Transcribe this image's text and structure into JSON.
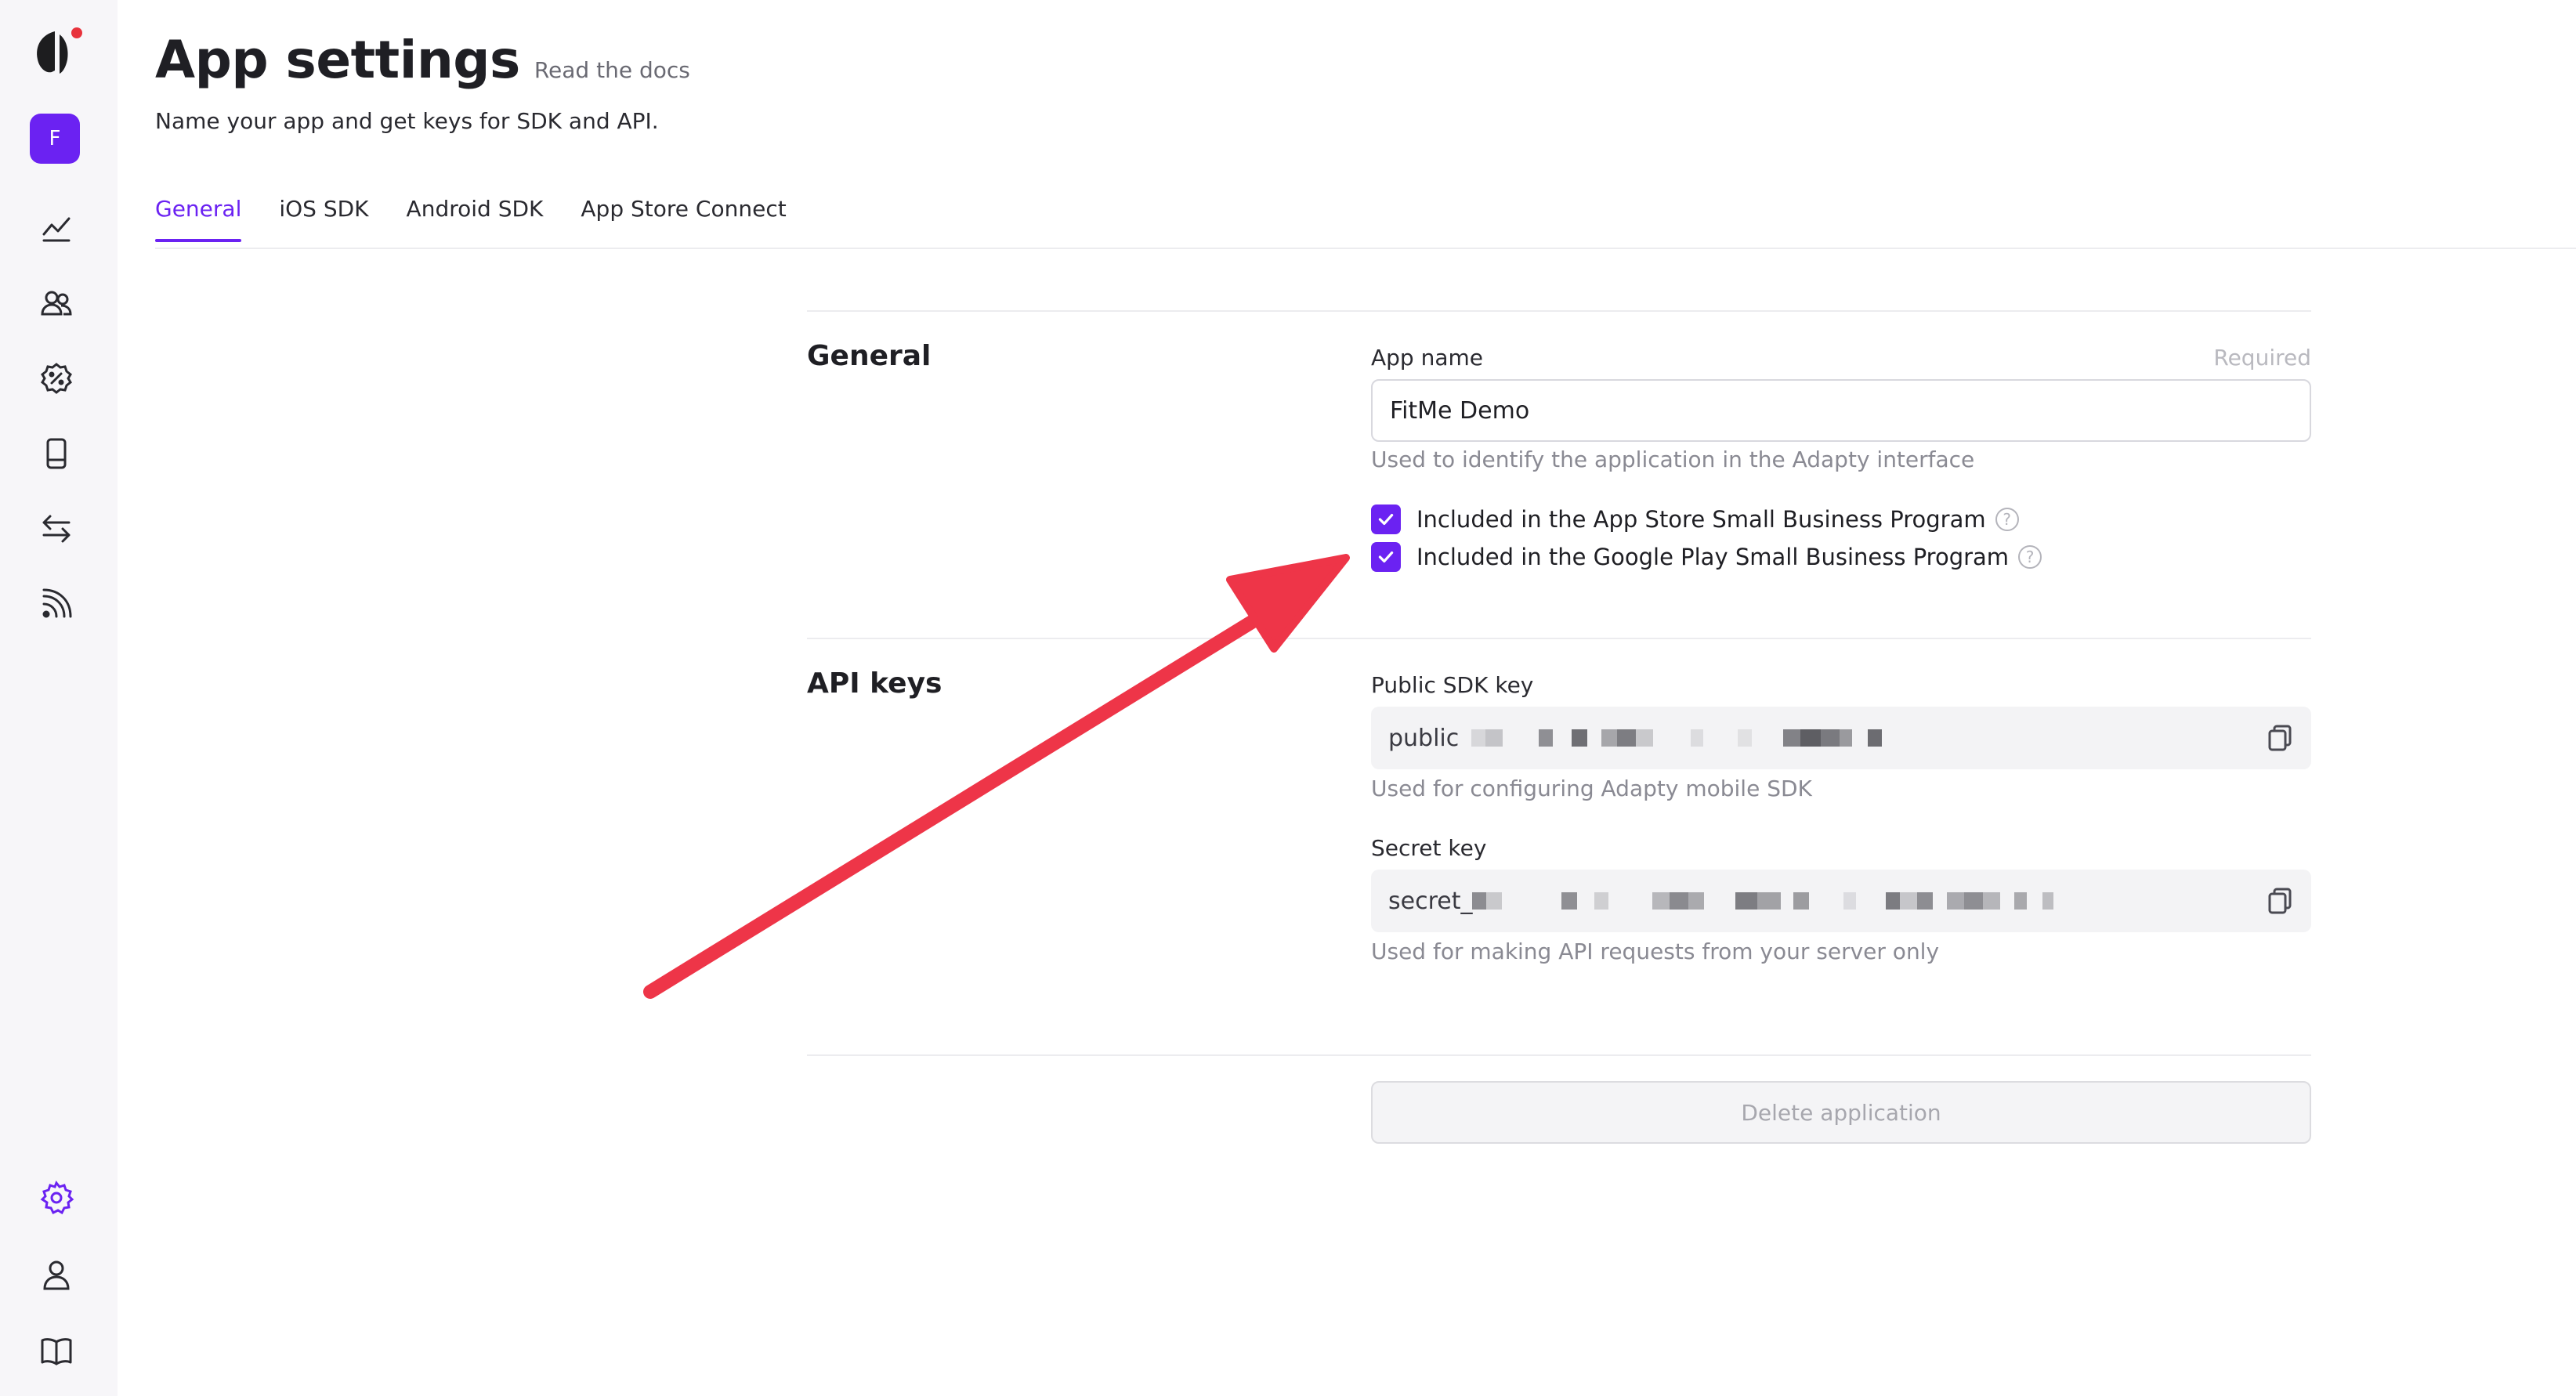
{
  "sidebar": {
    "avatar_letter": "F",
    "accent_color": "#6b22f2",
    "logo_dot_color": "#e8323c",
    "nav_icons": [
      "analytics-icon",
      "users-icon",
      "discount-icon",
      "device-icon",
      "transfer-icon",
      "rss-icon"
    ],
    "bottom_icons": [
      "settings-gear-icon",
      "profile-icon",
      "docs-book-icon"
    ]
  },
  "header": {
    "title": "App settings",
    "docs_link": "Read the docs",
    "subtitle": "Name your app and get keys for SDK and API."
  },
  "tabs": [
    {
      "label": "General",
      "active": true
    },
    {
      "label": "iOS SDK",
      "active": false
    },
    {
      "label": "Android SDK",
      "active": false
    },
    {
      "label": "App Store Connect",
      "active": false
    }
  ],
  "general": {
    "section_title": "General",
    "app_name_label": "App name",
    "required_label": "Required",
    "app_name_value": "FitMe Demo",
    "app_name_help": "Used to identify the application in the Adapty interface",
    "checkboxes": [
      {
        "label": "Included in the App Store Small Business Program",
        "checked": true
      },
      {
        "label": "Included in the Google Play Small Business Program",
        "checked": true
      }
    ]
  },
  "api_keys": {
    "section_title": "API keys",
    "public_label": "Public SDK key",
    "public_prefix": "public",
    "public_help": "Used for configuring Adapty mobile SDK",
    "secret_label": "Secret key",
    "secret_prefix": "secret_",
    "secret_help": "Used for making API requests from your server only"
  },
  "delete_button": "Delete application",
  "annotation": {
    "arrow_color": "#ee3548"
  }
}
